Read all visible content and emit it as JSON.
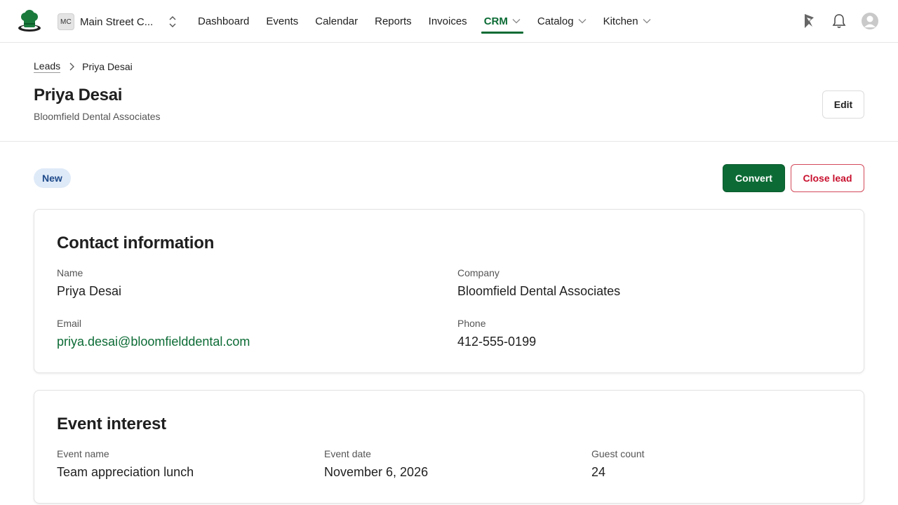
{
  "topnav": {
    "org_initials": "MC",
    "org_name": "Main Street C...",
    "items": [
      {
        "label": "Dashboard",
        "active": false,
        "dropdown": false
      },
      {
        "label": "Events",
        "active": false,
        "dropdown": false
      },
      {
        "label": "Calendar",
        "active": false,
        "dropdown": false
      },
      {
        "label": "Reports",
        "active": false,
        "dropdown": false
      },
      {
        "label": "Invoices",
        "active": false,
        "dropdown": false
      },
      {
        "label": "CRM",
        "active": true,
        "dropdown": true
      },
      {
        "label": "Catalog",
        "active": false,
        "dropdown": true
      },
      {
        "label": "Kitchen",
        "active": false,
        "dropdown": true
      }
    ],
    "icons": [
      "pin-icon",
      "bell-icon",
      "user-avatar-icon"
    ]
  },
  "breadcrumb": {
    "parent": "Leads",
    "current": "Priya Desai"
  },
  "header": {
    "title": "Priya Desai",
    "subtitle": "Bloomfield Dental Associates",
    "edit_label": "Edit"
  },
  "status": {
    "badge": "New",
    "convert_label": "Convert",
    "close_label": "Close lead"
  },
  "contact": {
    "title": "Contact information",
    "name_label": "Name",
    "name_value": "Priya Desai",
    "company_label": "Company",
    "company_value": "Bloomfield Dental Associates",
    "email_label": "Email",
    "email_value": "priya.desai@bloomfielddental.com",
    "phone_label": "Phone",
    "phone_value": "412-555-0199"
  },
  "event": {
    "title": "Event interest",
    "name_label": "Event name",
    "name_value": "Team appreciation lunch",
    "date_label": "Event date",
    "date_value": "November 6, 2026",
    "guests_label": "Guest count",
    "guests_value": "24"
  },
  "colors": {
    "accent": "#0c6b35",
    "danger": "#c8102e",
    "badge_bg": "#dfeaf8",
    "badge_text": "#1e4a8a"
  }
}
